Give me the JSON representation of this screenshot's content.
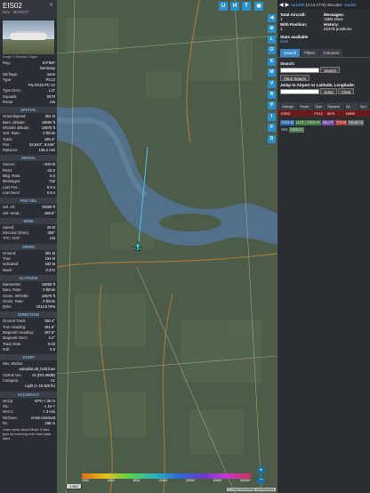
{
  "aircraft": {
    "callsign": "EIS02",
    "hex_line": "Hex : 3D7CC7",
    "photo_credit": "Image © Mathias Grägel",
    "fields": [
      {
        "k": "Reg.:",
        "v": "D-FIMT"
      },
      {
        "k": "",
        "v": "Germany"
      },
      {
        "k": "DB flags:",
        "v": "none"
      },
      {
        "k": "Type:",
        "v": "PC12"
      },
      {
        "k": "",
        "v": "PILATUS PC-12"
      },
      {
        "k": "Type Desc.:",
        "v": "L1T"
      },
      {
        "k": "Squawk:",
        "v": "5070"
      },
      {
        "k": "Route:",
        "v": "n/a"
      }
    ]
  },
  "sections": [
    {
      "title": "SPATIAL",
      "rows": [
        {
          "k": "Groundspeed:",
          "v": "261 kt"
        },
        {
          "k": "Baro. altitude:",
          "v": "16000 ft"
        },
        {
          "k": "WGS84 altitude:",
          "v": "16675 ft"
        },
        {
          "k": "Vert. Rate:",
          "v": "0 ft/min"
        },
        {
          "k": "Track:",
          "v": "190.4°"
        },
        {
          "k": "Pos.:",
          "v": "53.543°, 9.648°"
        },
        {
          "k": "Distance:",
          "v": "135.1 nmi"
        }
      ]
    },
    {
      "title": "SIGNAL",
      "rows": [
        {
          "k": "Source:",
          "v": "ADS-B"
        },
        {
          "k": "RSSI:",
          "v": "-22.0"
        },
        {
          "k": "Msg. Rate:",
          "v": "6.0"
        },
        {
          "k": "Messages:",
          "v": "732"
        },
        {
          "k": "Last Pos.:",
          "v": "0.9 s"
        },
        {
          "k": "Last Seen:",
          "v": "0.6 s"
        }
      ]
    },
    {
      "title": "FMS SEL",
      "rows": [
        {
          "k": "Sel. Alt.:",
          "v": "16000 ft"
        },
        {
          "k": "Sel. Head.:",
          "v": "189.8°"
        }
      ]
    },
    {
      "title": "WIND",
      "rows": [
        {
          "k": "Speed:",
          "v": "26 kt"
        },
        {
          "k": "Direction (from):",
          "v": "300°"
        },
        {
          "k": "TAT / OAT:",
          "v": "n/a"
        }
      ]
    },
    {
      "title": "SPEED",
      "rows": [
        {
          "k": "Ground:",
          "v": "261 kt"
        },
        {
          "k": "True:",
          "v": "234 kt"
        },
        {
          "k": "Indicated:",
          "v": "182 kt"
        },
        {
          "k": "Mach:",
          "v": "0.372"
        }
      ]
    },
    {
      "title": "ALTITUDE",
      "rows": [
        {
          "k": "Barometric:",
          "v": "16000 ft"
        },
        {
          "k": "Baro. Rate:",
          "v": "0 ft/min"
        },
        {
          "k": "Geom. WGS84:",
          "v": "16675 ft"
        },
        {
          "k": "Geom. Rate:",
          "v": "0 ft/min"
        },
        {
          "k": "QNH:",
          "v": "1013.6 hPa"
        }
      ]
    },
    {
      "title": "DIRECTION",
      "rows": [
        {
          "k": "Ground Track:",
          "v": "190.4°"
        },
        {
          "k": "True Heading:",
          "v": "191.6°"
        },
        {
          "k": "Magnetic Heading:",
          "v": "187.6°"
        },
        {
          "k": "Magnetic Decl.:",
          "v": "4.2°"
        },
        {
          "k": "Track Rate:",
          "v": "0.03"
        },
        {
          "k": "Roll:",
          "v": "0.5"
        }
      ]
    },
    {
      "title": "STUFF",
      "rows": [
        {
          "k": "Nav. Modes:",
          "v": ""
        },
        {
          "k": "",
          "v": "autopilot,alt_hold,lnav"
        },
        {
          "k": "ADS-B Ver.:",
          "v": "v2 (DO-260B)"
        },
        {
          "k": "Category:",
          "v": "A1"
        },
        {
          "k": "",
          "v": "Light (< 15 500 lb)"
        }
      ]
    },
    {
      "title": "ACCURACY",
      "rows": [
        {
          "k": "NACp:",
          "v": "EPU < 30 m"
        },
        {
          "k": "SIL:",
          "v": "≤ 1e-7"
        },
        {
          "k": "NACv:",
          "v": "< 3 m/s"
        },
        {
          "k": "NICbaro:",
          "v": "cross-checked"
        },
        {
          "k": "Rc:",
          "v": "186 m"
        }
      ]
    }
  ],
  "footer_note": "Learn more about Mode S data type by hovering over each data label.",
  "map": {
    "top_buttons": [
      "U",
      "H",
      "T"
    ],
    "side_buttons": [
      "L",
      "O",
      "K",
      "M",
      "V",
      "R",
      "P",
      "I",
      "F",
      "D"
    ],
    "scale": "1 NM",
    "attribution": "© OpenStreetMap contributors.",
    "altitude_ticks": [
      "1500",
      "4000",
      "8000",
      "12000",
      "20000",
      "30000",
      "40000+"
    ]
  },
  "right": {
    "version_link": "tar1090",
    "version_text": "(3.14.1776) decoder:",
    "decoder_link": "readsb",
    "stats": [
      {
        "label": "Total Aircraft:",
        "value": "1"
      },
      {
        "label": "Messages:",
        "value": "1580.2/sec"
      },
      {
        "label": "With Position:",
        "value": "1"
      },
      {
        "label": "History:",
        "value": "22376 positions"
      }
    ],
    "stats_line": "Stats available",
    "stats_link": "here",
    "tabs": [
      "Search",
      "Filters",
      "Columns"
    ],
    "search_label": "Search:",
    "search_button": "Search",
    "clear_search": "Clear Search",
    "jump_label": "Jump to Airport or Latitude, Longitude:",
    "jump_button": "Jump",
    "clear_button": "Clear",
    "table_headers": [
      "",
      "Callsign",
      "Route",
      "Type",
      "Squawk",
      "Alt.",
      "Spd"
    ],
    "table_rows": [
      [
        "",
        "EIS02",
        "",
        "PC12",
        "5070",
        "16000",
        ""
      ]
    ],
    "legend": [
      {
        "text": "ADS-B",
        "bg": "#2f6bb0"
      },
      {
        "text": "UAT / ADS-R",
        "bg": "#3d7a3d"
      },
      {
        "text": "MLAT",
        "bg": "#7a4aa8"
      },
      {
        "text": "TIS-B",
        "bg": "#b03a3a"
      },
      {
        "text": "Mode-S",
        "bg": "#666666"
      },
      {
        "text": "AIS",
        "bg": "#2b2e33"
      },
      {
        "text": "ADS-C",
        "bg": "#4f7d4f"
      }
    ]
  }
}
